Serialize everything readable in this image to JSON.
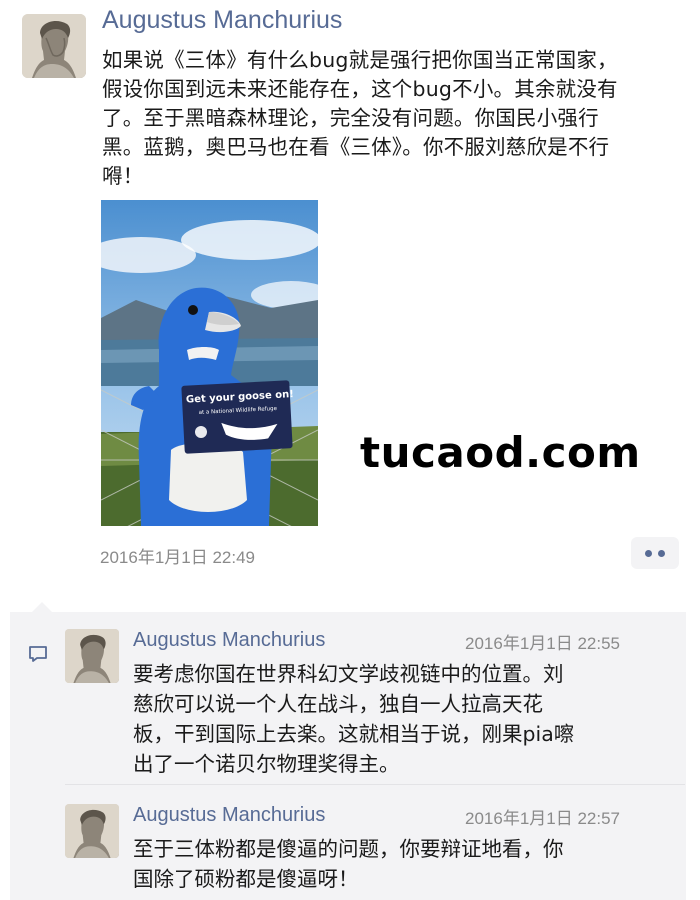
{
  "post": {
    "author": "Augustus Manchurius",
    "text_lines": [
      "如果说《三体》有什么bug就是强行把你国当正常国家，",
      "假设你国到远未来还能存在，这个bug不小。其余就没有",
      "了。至于黑暗森林理论，完全没有问题。你国民小强行",
      "黑。蓝鹅，奥巴马也在看《三体》。你不服刘慈欣是不行",
      "嘚！"
    ],
    "photo_banner_text": "Get your goose on!",
    "photo_banner_subtext": "at a National Wildlife Refuge",
    "timestamp": "2016年1月1日 22:49"
  },
  "watermark": "tucaod.com",
  "comments": [
    {
      "author": "Augustus Manchurius",
      "time": "2016年1月1日 22:55",
      "text_lines": [
        "要考虑你国在世界科幻文学歧视链中的位置。刘",
        "慈欣可以说一个人在战斗，独自一人拉高天花",
        "板，干到国际上去楽。这就相当于说，刚果pia嚓",
        "出了一个诺贝尔物理奖得主。"
      ]
    },
    {
      "author": "Augustus Manchurius",
      "time": "2016年1月1日 22:57",
      "text_lines": [
        "至于三体粉都是傻逼的问题，你要辩证地看，你",
        "国除了硕粉都是傻逼呀！"
      ]
    }
  ],
  "colors": {
    "name_blue": "#576b95",
    "comment_bg": "#f3f3f5",
    "timestamp_gray": "#8a8a8a"
  },
  "icons": {
    "more": "more-dots-icon",
    "comment": "comment-bubble-icon"
  }
}
